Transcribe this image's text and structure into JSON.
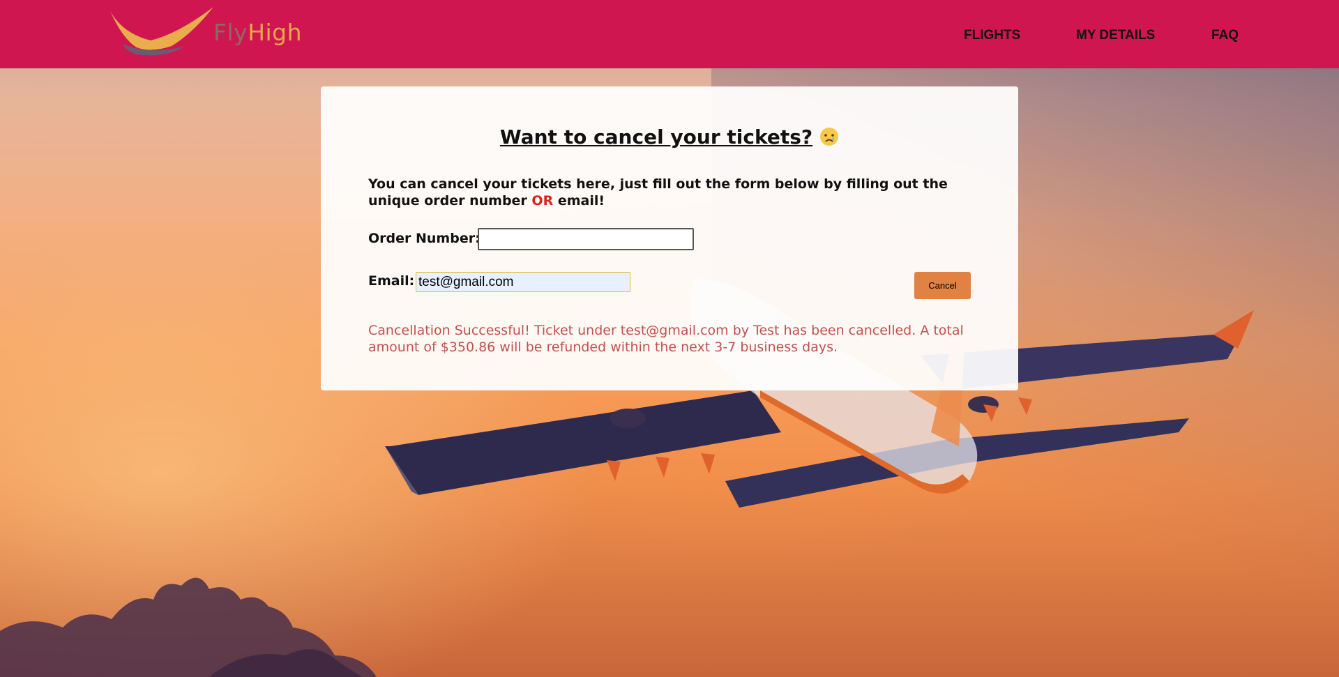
{
  "brand": {
    "name_part1": "Fly",
    "name_part2": "High",
    "primary_color": "#d01650",
    "accent_color": "#e7a947"
  },
  "nav": {
    "items": [
      {
        "label": "FLIGHTS"
      },
      {
        "label": "MY DETAILS"
      },
      {
        "label": "FAQ"
      }
    ]
  },
  "card": {
    "title": "Want to cancel your tickets?",
    "title_icon": "crying-face-icon",
    "intro_before": "You can cancel your tickets here, just fill out the form below by filling out the unique order number ",
    "intro_or": "OR",
    "intro_after": " email!",
    "order_number": {
      "label": "Order Number:",
      "value": ""
    },
    "email": {
      "label": "Email:",
      "value": "test@gmail.com"
    },
    "cancel_button": "Cancel",
    "result_message": "Cancellation Successful! Ticket under test@gmail.com by Test has been cancelled. A total amount of $350.86 will be refunded within the next 3-7 business days."
  }
}
